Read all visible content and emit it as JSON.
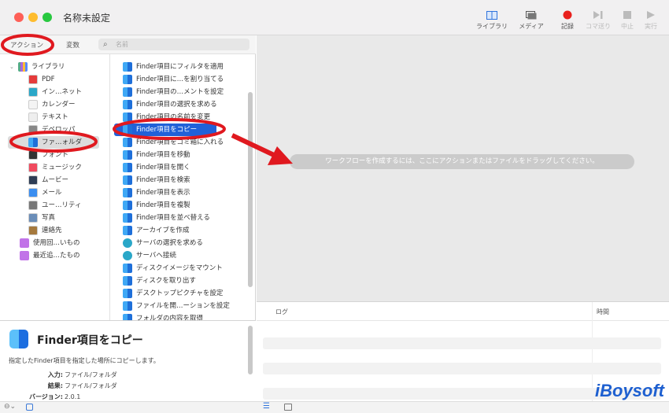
{
  "window": {
    "title": "名称未設定"
  },
  "toolbar": [
    {
      "label": "ライブラリ",
      "icon": "library-icon",
      "enabled": true
    },
    {
      "label": "メディア",
      "icon": "media-icon",
      "enabled": true
    },
    {
      "label": "記録",
      "icon": "record-icon",
      "enabled": true
    },
    {
      "label": "コマ送り",
      "icon": "step-icon",
      "enabled": false
    },
    {
      "label": "中止",
      "icon": "stop-icon",
      "enabled": false
    },
    {
      "label": "実行",
      "icon": "run-icon",
      "enabled": false
    }
  ],
  "tabs": {
    "actions": "アクション",
    "variables": "変数"
  },
  "search": {
    "placeholder": "名前"
  },
  "library": {
    "root": "ライブラリ",
    "items": [
      "PDF",
      "イン…ネット",
      "カレンダー",
      "テキスト",
      "デベロッパ",
      "ファ…ォルダ",
      "フォント",
      "ミュージック",
      "ムービー",
      "メール",
      "ユー…リティ",
      "写真",
      "連絡先"
    ],
    "selected": "ファ…ォルダ",
    "smart": [
      "使用回…いもの",
      "最近追…たもの"
    ]
  },
  "actions": {
    "items": [
      "Finder項目にフィルタを適用",
      "Finder項目に…を割り当てる",
      "Finder項目の…メントを設定",
      "Finder項目の選択を求める",
      "Finder項目の名前を変更",
      "Finder項目をコピー",
      "Finder項目をゴミ箱に入れる",
      "Finder項目を移動",
      "Finder項目を開く",
      "Finder項目を検索",
      "Finder項目を表示",
      "Finder項目を複製",
      "Finder項目を並べ替える",
      "アーカイブを作成",
      "サーバの選択を求める",
      "サーバへ接続",
      "ディスクイメージをマウント",
      "ディスクを取り出す",
      "デスクトップピクチャを設定",
      "ファイルを開…ーションを設定",
      "フォルダの内容を取得"
    ],
    "selected": "Finder項目をコピー"
  },
  "description": {
    "title": "Finder項目をコピー",
    "text": "指定したFinder項目を指定した場所にコピーします。",
    "input_label": "入力:",
    "input": "ファイル/フォルダ",
    "result_label": "結果:",
    "result": "ファイル/フォルダ",
    "version_label": "バージョン:",
    "version": "2.0.1"
  },
  "workflow": {
    "hint": "ワークフローを作成するには、ここにアクションまたはファイルをドラッグしてください。"
  },
  "log": {
    "col_log": "ログ",
    "col_time": "時間"
  },
  "watermark": "iBoysoft",
  "colors": {
    "selection": "#2161d8",
    "annotation": "#e0191f",
    "watermark": "#1d5fd0"
  }
}
